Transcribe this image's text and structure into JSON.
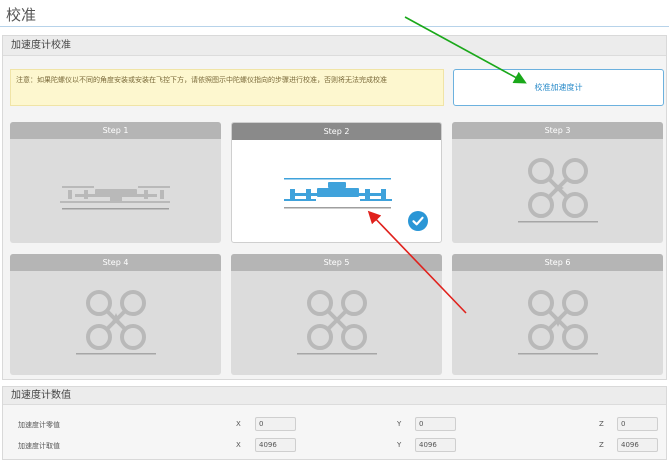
{
  "page": {
    "title": "校准"
  },
  "accel_panel": {
    "title": "加速度计校准",
    "notice": "注意：如果陀螺仪以不同的角度安装或安装在飞控下方，请依照图示中陀螺仪指向的步骤进行校准，否则将无法完成校准",
    "calibrate_button": "校准加速度计",
    "steps": [
      {
        "label": "Step 1",
        "state": "pending",
        "icon": "drone-level-side-icon"
      },
      {
        "label": "Step 2",
        "state": "completed",
        "icon": "drone-flipped-side-icon"
      },
      {
        "label": "Step 3",
        "state": "pending",
        "icon": "drone-nose-right-icon"
      },
      {
        "label": "Step 4",
        "state": "pending",
        "icon": "drone-nose-up-icon"
      },
      {
        "label": "Step 5",
        "state": "pending",
        "icon": "drone-top-view-icon"
      },
      {
        "label": "Step 6",
        "state": "pending",
        "icon": "drone-nose-down-icon"
      }
    ]
  },
  "values_panel": {
    "title": "加速度计数值",
    "rows": [
      {
        "label": "加速度计零值",
        "x": "0",
        "y": "0",
        "z": "0"
      },
      {
        "label": "加速度计取值",
        "x": "4096",
        "y": "4096",
        "z": "4096"
      }
    ],
    "axes": {
      "x": "X",
      "y": "Y",
      "z": "Z"
    }
  },
  "colors": {
    "accent": "#2a8bc9",
    "active_drone": "#3fa2db",
    "inactive_drone": "#b9b9b9",
    "annotation_green": "#1aa81a",
    "annotation_red": "#e0211c"
  }
}
